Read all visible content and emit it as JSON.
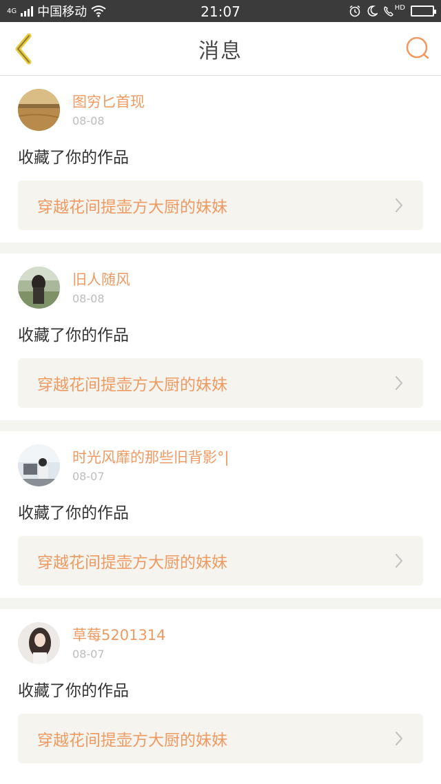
{
  "status_bar": {
    "network_type": "4G",
    "carrier": "中国移动",
    "time": "21:07",
    "hd_label": "HD"
  },
  "nav": {
    "title": "消息",
    "back_icon": "chevron-left-icon",
    "search_icon": "search-icon"
  },
  "colors": {
    "accent": "#ef9a62",
    "back_icon": "#e8c93a",
    "status_bar_bg": "#3b3b3b",
    "card_link_bg": "#f5f4ef",
    "separator_bg": "#f4f4f1",
    "date_gray": "#bdbdbd"
  },
  "messages": [
    {
      "username": "图穷匕首现",
      "date": "08-08",
      "action": "收藏了你的作品",
      "work_title": "穿越花间提壶方大厨的妹妹"
    },
    {
      "username": "旧人随风",
      "date": "08-08",
      "action": "收藏了你的作品",
      "work_title": "穿越花间提壶方大厨的妹妹"
    },
    {
      "username": "时光风靡的那些旧背影°|",
      "date": "08-07",
      "action": "收藏了你的作品",
      "work_title": "穿越花间提壶方大厨的妹妹"
    },
    {
      "username": "草莓5201314",
      "date": "08-07",
      "action": "收藏了你的作品",
      "work_title": "穿越花间提壶方大厨的妹妹"
    }
  ]
}
